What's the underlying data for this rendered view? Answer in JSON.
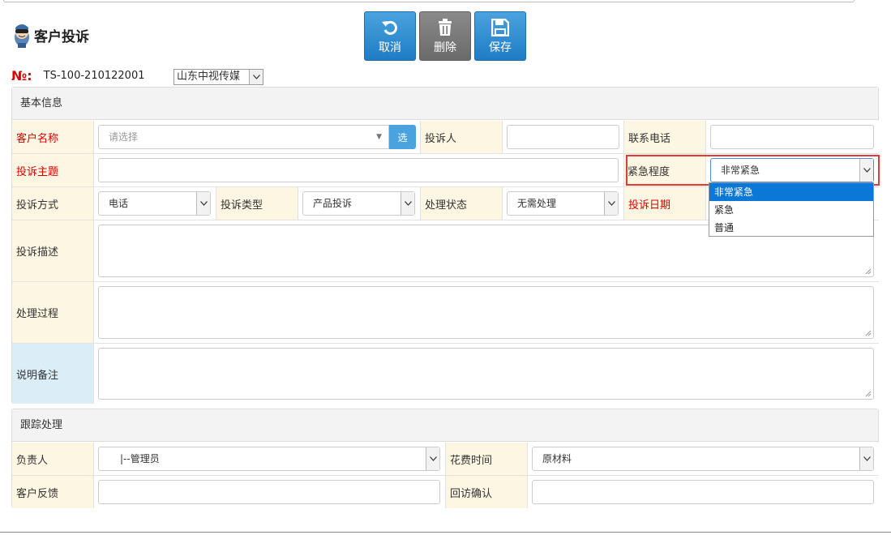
{
  "page": {
    "title": "客户投诉"
  },
  "toolbar": {
    "cancel_label": "取消",
    "delete_label": "删除",
    "save_label": "保存"
  },
  "doc": {
    "no_label": "№:",
    "no_value": "TS-100-210122001",
    "company": "山东中视传媒"
  },
  "basic": {
    "heading": "基本信息",
    "customer_label": "客户名称",
    "customer_placeholder": "请选择",
    "pick_label": "选",
    "complainant_label": "投诉人",
    "complainant_value": "",
    "phone_label": "联系电话",
    "phone_value": "",
    "subject_label": "投诉主题",
    "subject_value": "",
    "urgency_label": "紧急程度",
    "urgency_value": "非常紧急",
    "urgency_options": [
      "非常紧急",
      "紧急",
      "普通"
    ],
    "method_label": "投诉方式",
    "method_value": "电话",
    "type_label": "投诉类型",
    "type_value": "产品投诉",
    "status_label": "处理状态",
    "status_value": "无需处理",
    "date_label": "投诉日期",
    "desc_label": "投诉描述",
    "process_label": "处理过程",
    "remark_label": "说明备注"
  },
  "tracking": {
    "heading": "跟踪处理",
    "owner_label": "负责人",
    "owner_value": "|--管理员",
    "time_label": "花费时间",
    "time_value": "原材料",
    "feedback_label": "客户反馈",
    "feedback_value": "",
    "revisit_label": "回访确认",
    "revisit_value": ""
  },
  "colors": {
    "accent_blue": "#1f7cc4",
    "required_red": "#dd0000",
    "label_bg": "#fdf6e3",
    "highlight_red": "#e53935"
  }
}
